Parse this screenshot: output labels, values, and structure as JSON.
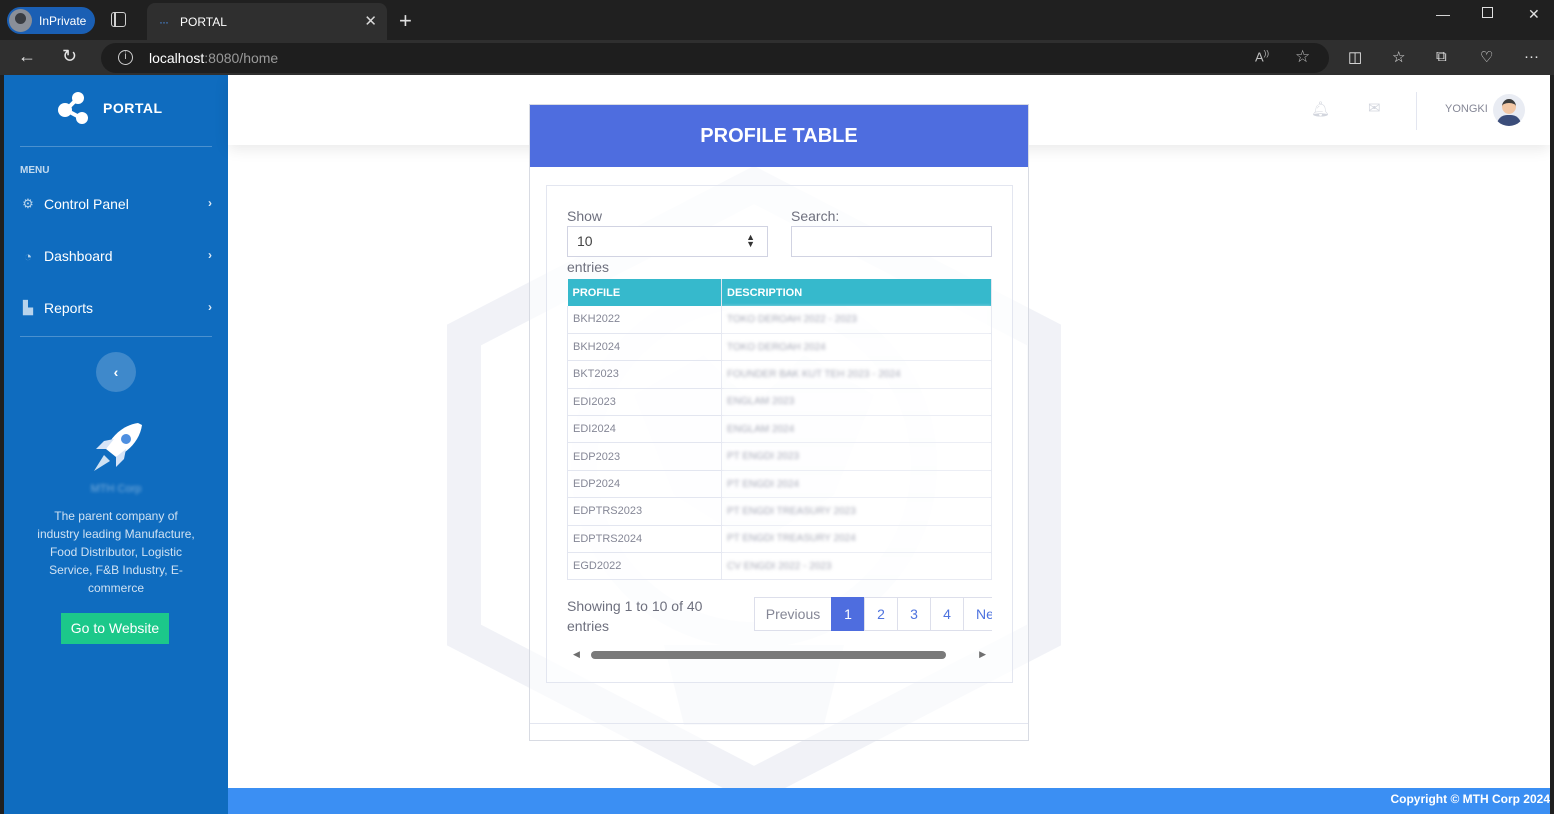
{
  "browser": {
    "inprivate_label": "InPrivate",
    "tab_title": "PORTAL",
    "tab_favicon": "···",
    "url_host": "localhost",
    "url_path": ":8080/home"
  },
  "sidebar": {
    "brand": "PORTAL",
    "menu_label": "MENU",
    "items": [
      {
        "label": "Control Panel",
        "icon": "gear-icon"
      },
      {
        "label": "Dashboard",
        "icon": "gauge-icon"
      },
      {
        "label": "Reports",
        "icon": "bar-chart-icon"
      }
    ],
    "toggle_glyph": "‹",
    "corp_name": "MTH Corp",
    "corp_description": "The parent company of industry leading Manufacture, Food Distributor, Logistic Service, F&B Industry, E-commerce",
    "cta_label": "Go to Website"
  },
  "topbar": {
    "user_name": "YONGKI"
  },
  "card": {
    "title": "PROFILE TABLE",
    "show_label": "Show",
    "entries_label": "entries",
    "length_value": "10",
    "search_label": "Search:",
    "search_value": "",
    "columns": [
      "PROFILE",
      "DESCRIPTION"
    ],
    "rows": [
      {
        "profile": "BKH2022",
        "description": "TOKO DEROAH 2022 - 2023"
      },
      {
        "profile": "BKH2024",
        "description": "TOKO DEROAH 2024"
      },
      {
        "profile": "BKT2023",
        "description": "FOUNDER BAK KUT TEH 2023 - 2024"
      },
      {
        "profile": "EDI2023",
        "description": "ENGLAM 2023"
      },
      {
        "profile": "EDI2024",
        "description": "ENGLAM 2024"
      },
      {
        "profile": "EDP2023",
        "description": "PT ENGDI 2023"
      },
      {
        "profile": "EDP2024",
        "description": "PT ENGDI 2024"
      },
      {
        "profile": "EDPTRS2023",
        "description": "PT ENGDI TREASURY 2023"
      },
      {
        "profile": "EDPTRS2024",
        "description": "PT ENGDI TREASURY 2024"
      },
      {
        "profile": "EGD2022",
        "description": "CV ENGDI 2022 - 2023"
      }
    ],
    "showing_text": "Showing 1 to 10 of 40 entries",
    "pager": {
      "previous": "Previous",
      "pages": [
        "1",
        "2",
        "3",
        "4"
      ],
      "active_page": "1",
      "next": "Ne"
    }
  },
  "footer": {
    "copyright": "Copyright © MTH Corp 2024"
  },
  "colors": {
    "sidebar": "#0f6cbf",
    "card_header": "#4e6ddf",
    "table_header": "#36b9cc",
    "cta": "#1cc88a",
    "footer": "#3b8ff3"
  }
}
